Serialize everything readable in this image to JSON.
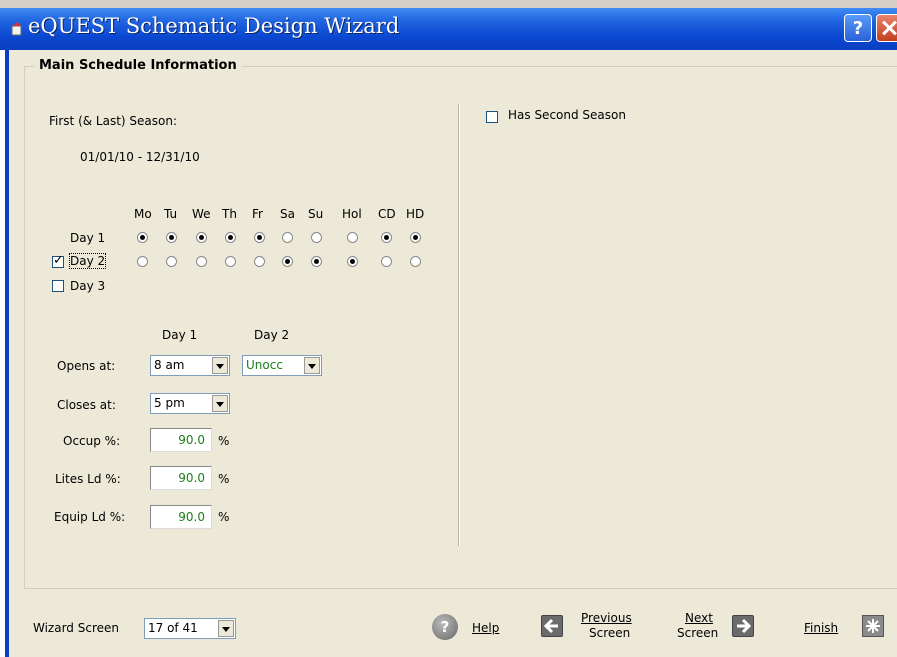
{
  "window": {
    "title": "eQUEST Schematic Design Wizard",
    "help_button": "?"
  },
  "group": {
    "title": "Main Schedule Information"
  },
  "season": {
    "label": "First (& Last) Season:",
    "range": "01/01/10 - 12/31/10",
    "second_season_label": "Has Second Season",
    "second_season_checked": false
  },
  "days_grid": {
    "columns": [
      "Mo",
      "Tu",
      "We",
      "Th",
      "Fr",
      "Sa",
      "Su",
      "Hol",
      "CD",
      "HD"
    ],
    "rows": [
      {
        "label": "Day 1",
        "has_checkbox": false,
        "selected": [
          true,
          true,
          true,
          true,
          true,
          false,
          false,
          false,
          true,
          true
        ]
      },
      {
        "label": "Day 2",
        "has_checkbox": true,
        "checked": true,
        "selected": [
          false,
          false,
          false,
          false,
          false,
          true,
          true,
          true,
          false,
          false
        ]
      },
      {
        "label": "Day 3",
        "has_checkbox": true,
        "checked": false,
        "selected": []
      }
    ]
  },
  "schedule": {
    "col_day1": "Day 1",
    "col_day2": "Day 2",
    "opens_label": "Opens at:",
    "opens_day1": "8 am",
    "opens_day2": "Unocc",
    "closes_label": "Closes at:",
    "closes_day1": "5 pm",
    "occup_label": "Occup %:",
    "occup_value": "90.0",
    "lites_label": "Lites Ld %:",
    "lites_value": "90.0",
    "equip_label": "Equip Ld %:",
    "equip_value": "90.0",
    "percent": "%"
  },
  "footer": {
    "wizard_screen_label": "Wizard Screen",
    "wizard_screen_value": "17 of 41",
    "help": "Help",
    "previous_line1": "Previous",
    "previous_line2": "Screen",
    "next_line1": "Next",
    "next_line2": "Screen",
    "finish": "Finish"
  }
}
